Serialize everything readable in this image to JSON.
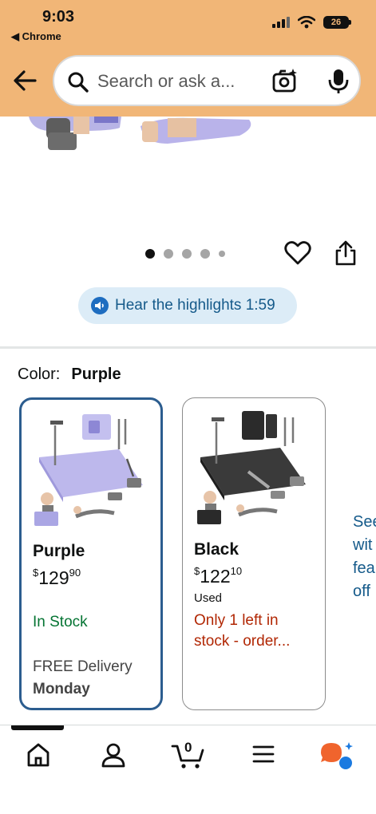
{
  "status": {
    "time": "9:03",
    "back_app": "◀ Chrome",
    "battery": "26"
  },
  "search": {
    "placeholder": "Search or ask a..."
  },
  "carousel": {
    "dots": 5,
    "active": 0
  },
  "highlights": {
    "label": "Hear the highlights 1:59"
  },
  "color": {
    "label": "Color:",
    "selected": "Purple"
  },
  "variants": [
    {
      "name": "Purple",
      "price_symbol": "$",
      "price_whole": "129",
      "price_fraction": "90",
      "stock": "In Stock",
      "delivery_label": "FREE Delivery",
      "delivery_day": "Monday",
      "selected": true
    },
    {
      "name": "Black",
      "price_symbol": "$",
      "price_whole": "122",
      "price_fraction": "10",
      "condition": "Used",
      "stock": "Only 1 left in stock - order...",
      "selected": false
    }
  ],
  "see_more": {
    "line1": "See",
    "line2": "wit",
    "line3": "fea",
    "line4": "off"
  },
  "bottom_nav": {
    "cart_count": "0"
  },
  "colors": {
    "header_bg": "#f1b677",
    "link": "#155a8a",
    "in_stock": "#057433",
    "low_stock": "#b12704",
    "selected_border": "#2c5d8f"
  }
}
